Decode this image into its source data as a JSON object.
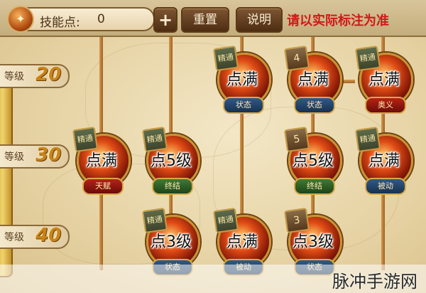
{
  "topbar": {
    "skill_points_label": "技能点:",
    "skill_points_value": "0",
    "plus_label": "+",
    "reset_label": "重置",
    "help_label": "说明",
    "note": "请以实际标注为准"
  },
  "levels": [
    {
      "label": "等级",
      "value": "20"
    },
    {
      "label": "等级",
      "value": "30"
    },
    {
      "label": "等级",
      "value": "40"
    }
  ],
  "nodes": [
    {
      "badge": "精通",
      "text": "点满",
      "tag": "状态",
      "tag_style": "blue"
    },
    {
      "badge": "4",
      "text": "点满",
      "tag": "状态",
      "tag_style": "blue"
    },
    {
      "badge": "精通",
      "text": "点满",
      "tag": "奥义",
      "tag_style": "red"
    },
    {
      "badge": "精通",
      "text": "点满",
      "tag": "天赋",
      "tag_style": "red"
    },
    {
      "badge": "精通",
      "text": "点5级",
      "tag": "终结",
      "tag_style": "green"
    },
    {
      "badge": "5",
      "text": "点5级",
      "tag": "终结",
      "tag_style": "green"
    },
    {
      "badge": "精通",
      "text": "点满",
      "tag": "被动",
      "tag_style": "blue"
    },
    {
      "badge": "精通",
      "text": "点3级",
      "tag": "状态",
      "tag_style": "blue"
    },
    {
      "badge": "精通",
      "text": "点满",
      "tag": "被动",
      "tag_style": "blue"
    },
    {
      "badge": "3",
      "text": "点3级",
      "tag": "状态",
      "tag_style": "blue"
    }
  ],
  "watermark": "脉冲手游网"
}
